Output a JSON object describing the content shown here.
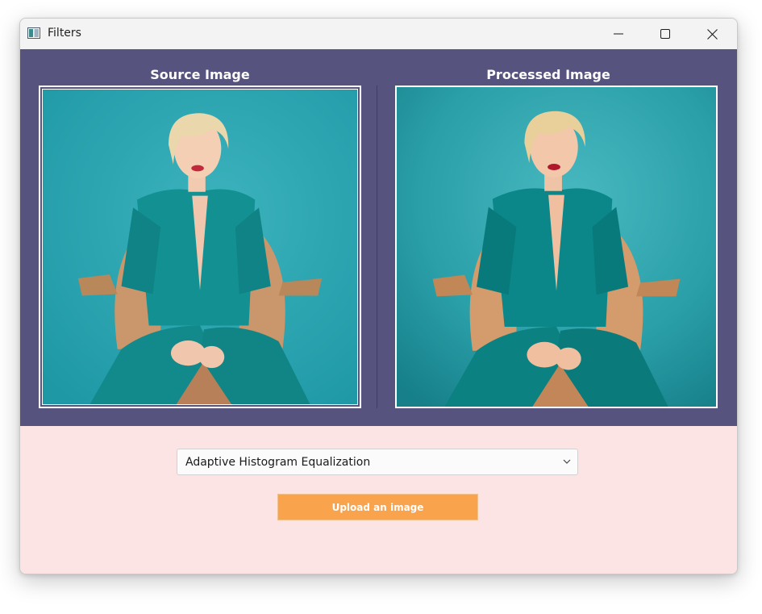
{
  "window": {
    "title": "Filters",
    "icon": "app-window-icon",
    "controls": [
      "minimize-icon",
      "maximize-icon",
      "close-icon"
    ]
  },
  "panels": {
    "source_title": "Source Image",
    "processed_title": "Processed Image"
  },
  "controls": {
    "filter_selected": "Adaptive Histogram Equalization",
    "upload_label": "Upload an image"
  },
  "colors": {
    "panel_background": "#56537e",
    "controls_background": "#fde4e4",
    "upload_button": "#f9a34d",
    "photo_backdrop": "#2fa3ad",
    "outfit": "#138f8f"
  }
}
